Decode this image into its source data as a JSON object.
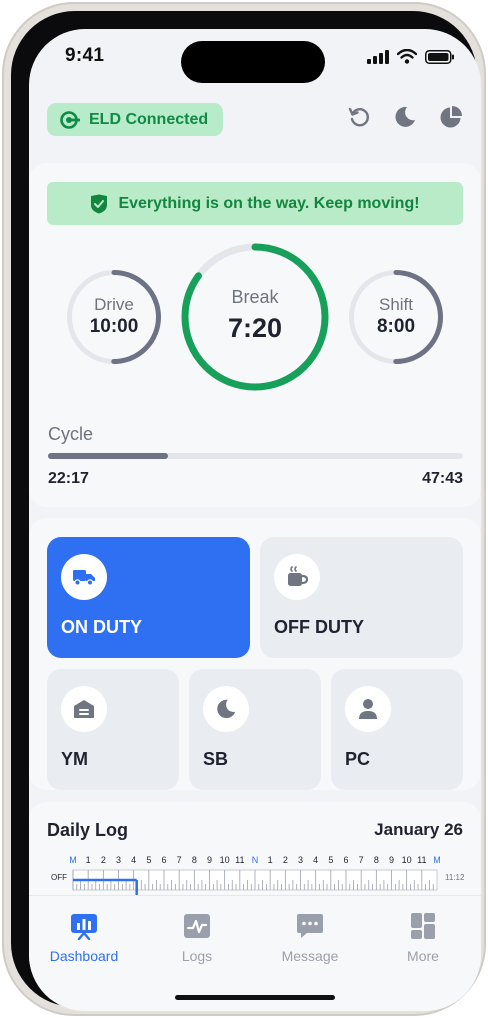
{
  "status_bar": {
    "time": "9:41",
    "icons": [
      "signal-icon",
      "wifi-icon",
      "battery-icon"
    ]
  },
  "header": {
    "eld_status": "ELD Connected",
    "actions": [
      "refresh-icon",
      "moon-icon",
      "pie-chart-icon"
    ]
  },
  "alert": {
    "message": "Everything is on the way. Keep moving!",
    "icon": "shield-check-icon"
  },
  "timers": {
    "drive": {
      "label": "Drive",
      "value": "10:00",
      "progress": 0.5
    },
    "break": {
      "label": "Break",
      "value": "7:20",
      "progress": 0.85
    },
    "shift": {
      "label": "Shift",
      "value": "8:00",
      "progress": 0.5
    }
  },
  "cycle": {
    "label": "Cycle",
    "used": "22:17",
    "remaining": "47:43",
    "progress": 0.29
  },
  "duty_status": {
    "on_duty": {
      "label": "ON DUTY",
      "icon": "truck-icon",
      "active": true
    },
    "off_duty": {
      "label": "OFF DUTY",
      "icon": "coffee-icon"
    },
    "ym": {
      "label": "YM",
      "icon": "yard-icon"
    },
    "sb": {
      "label": "SB",
      "icon": "moon-icon"
    },
    "pc": {
      "label": "PC",
      "icon": "person-icon"
    }
  },
  "daily_log": {
    "title": "Daily Log",
    "date": "January 26",
    "hours": [
      "M",
      "1",
      "2",
      "3",
      "4",
      "5",
      "6",
      "7",
      "8",
      "9",
      "10",
      "11",
      "N",
      "1",
      "2",
      "3",
      "4",
      "5",
      "6",
      "7",
      "8",
      "9",
      "10",
      "11",
      "M"
    ],
    "row_label": "OFF",
    "total": "11:12"
  },
  "tabs": [
    {
      "label": "Dashboard",
      "icon": "dashboard-icon",
      "active": true
    },
    {
      "label": "Logs",
      "icon": "logs-icon"
    },
    {
      "label": "Message",
      "icon": "message-icon"
    },
    {
      "label": "More",
      "icon": "grid-icon"
    }
  ],
  "colors": {
    "accent": "#2f6ff2",
    "success": "#12863f",
    "success_bg": "#b9ebc8",
    "break_ring": "#16a05a",
    "neutral_ring": "#6d7384"
  }
}
